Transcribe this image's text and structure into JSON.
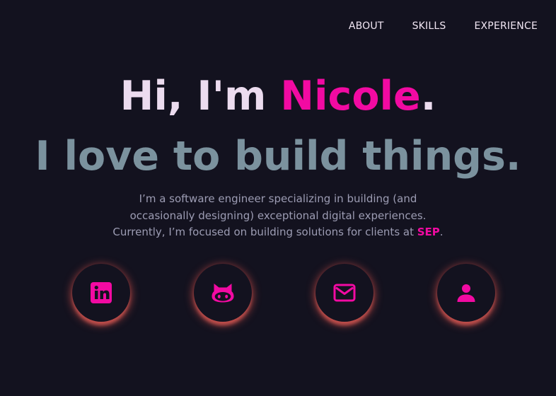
{
  "nav": {
    "items": [
      {
        "label": "ABOUT"
      },
      {
        "label": "SKILLS"
      },
      {
        "label": "EXPERIENCE"
      }
    ]
  },
  "hero": {
    "greeting_prefix": "Hi, I'm ",
    "name": "Nicole",
    "greeting_suffix": ".",
    "tagline": "I love to build things.",
    "intro_line1": "I’m a software engineer specializing in building (and",
    "intro_line2": "occasionally designing) exceptional digital experiences.",
    "intro_line3_prefix": "Currently, I’m focused on building solutions for clients at ",
    "company": "SEP",
    "intro_line3_suffix": "."
  },
  "social": [
    {
      "icon": "linkedin-icon"
    },
    {
      "icon": "github-icon"
    },
    {
      "icon": "email-icon"
    },
    {
      "icon": "profile-icon"
    }
  ],
  "colors": {
    "background": "#13121f",
    "accent": "#f20aa2",
    "headline": "#ecdcef",
    "tagline": "#7b929e",
    "body_text": "#9c9cb3",
    "glow": "#e6564f"
  }
}
